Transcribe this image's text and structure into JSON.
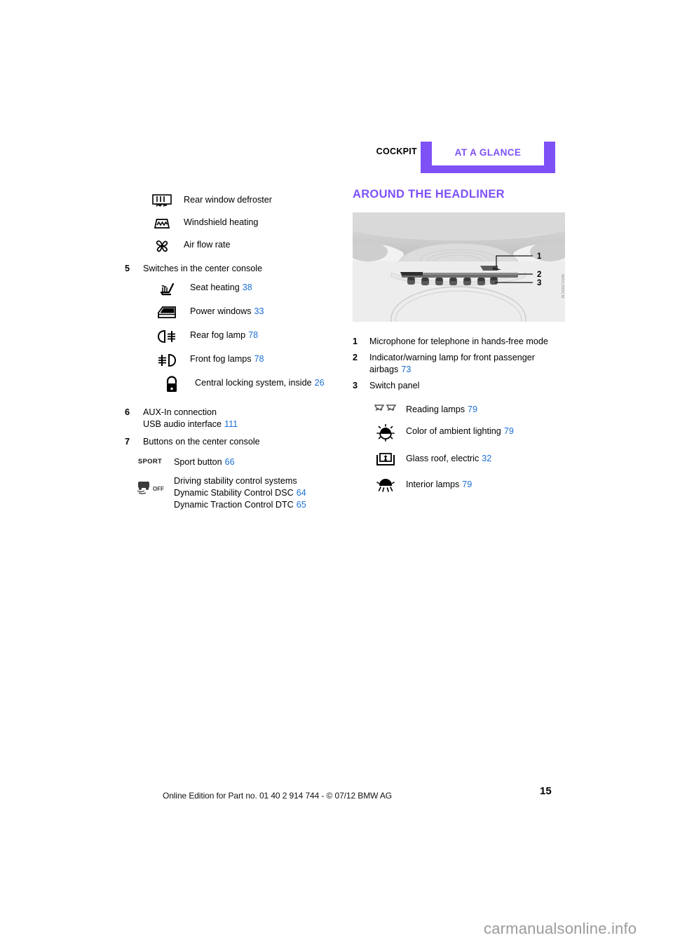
{
  "header": {
    "left_label": "COCKPIT",
    "right_label": "AT A GLANCE",
    "band_color": "#7e51f7"
  },
  "left_column": {
    "climate_symbols": [
      {
        "icon": "rear-window-defroster-icon",
        "label": "Rear window defroster",
        "page": ""
      },
      {
        "icon": "windshield-heating-icon",
        "label": "Windshield heating",
        "page": ""
      },
      {
        "icon": "air-flow-rate-icon",
        "label": "Air flow rate",
        "page": ""
      }
    ],
    "item5": {
      "number": "5",
      "text": "Switches in the center console",
      "symbols": [
        {
          "icon": "seat-heating-icon",
          "label": "Seat heating",
          "page": "38"
        },
        {
          "icon": "power-windows-icon",
          "label": "Power windows",
          "page": "33"
        },
        {
          "icon": "rear-fog-lamp-icon",
          "label": "Rear fog lamp",
          "page": "78"
        },
        {
          "icon": "front-fog-lamps-icon",
          "label": "Front fog lamps",
          "page": "78"
        },
        {
          "icon": "central-locking-icon",
          "label": "Central locking system, inside",
          "page": "26"
        }
      ]
    },
    "item6": {
      "number": "6",
      "line1": "AUX-In connection",
      "line2": "USB audio interface",
      "line2_page": "111"
    },
    "item7": {
      "number": "7",
      "text": "Buttons on the center console",
      "sport": {
        "icon": "sport-button-icon",
        "label": "Sport button",
        "page": "66"
      },
      "dsc": {
        "icon": "dsc-off-icon",
        "line1": "Driving stability control systems",
        "line2": "Dynamic Stability Control DSC",
        "line2_page": "64",
        "line3": "Dynamic Traction Control DTC",
        "line3_page": "65"
      }
    }
  },
  "right_column": {
    "title": "AROUND THE HEADLINER",
    "figure": {
      "name": "headliner-illustration",
      "callouts": [
        "1",
        "2",
        "3"
      ],
      "code": "MIN1300CM"
    },
    "callouts": [
      {
        "number": "1",
        "text": "Microphone for telephone in hands-free mode",
        "page": ""
      },
      {
        "number": "2",
        "text": "Indicator/warning lamp for front passenger airbags",
        "page": "73"
      },
      {
        "number": "3",
        "text": "Switch panel",
        "page": ""
      }
    ],
    "switch_panel_symbols": [
      {
        "icon": "reading-lamps-icon",
        "label": "Reading lamps",
        "page": "79"
      },
      {
        "icon": "ambient-lighting-icon",
        "label": "Color of ambient lighting",
        "page": "79"
      },
      {
        "icon": "glass-roof-icon",
        "label": "Glass roof, electric",
        "page": "32"
      },
      {
        "icon": "interior-lamps-icon",
        "label": "Interior lamps",
        "page": "79"
      }
    ]
  },
  "footer": {
    "edition_line": "Online Edition for Part no. 01 40 2 914 744 - © 07/12 BMW AG",
    "page_number": "15",
    "watermark": "carmanualsonline.info"
  },
  "colors": {
    "accent": "#7e51f7",
    "link": "#1a6fd4"
  }
}
